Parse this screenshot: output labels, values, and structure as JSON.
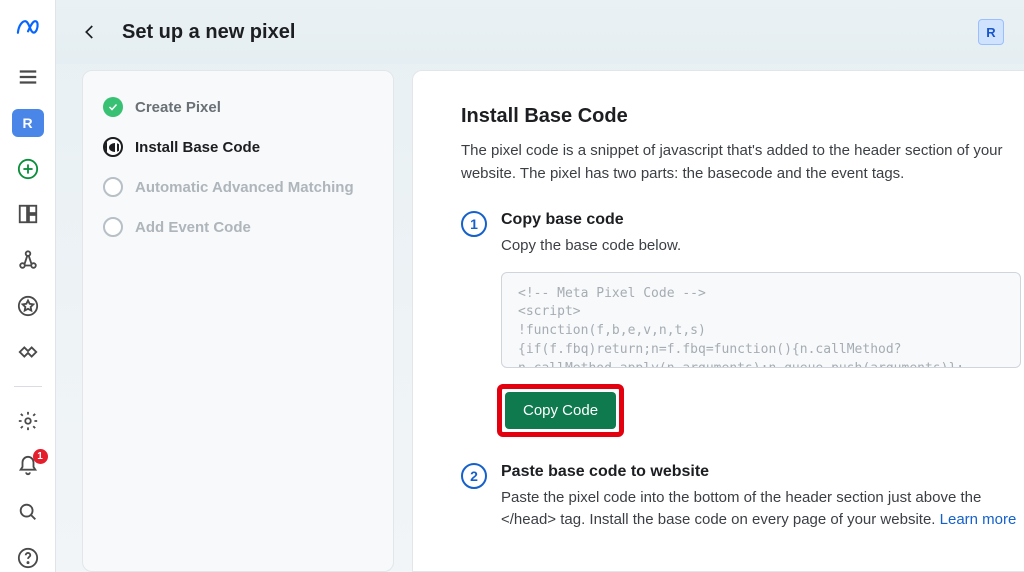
{
  "header": {
    "title": "Set up a new pixel",
    "account_badge": "R"
  },
  "sidebar": {
    "active_badge": "R",
    "notification_count": "1"
  },
  "stepper": {
    "steps": [
      {
        "label": "Create Pixel",
        "state": "done"
      },
      {
        "label": "Install Base Code",
        "state": "current"
      },
      {
        "label": "Automatic Advanced Matching",
        "state": "todo"
      },
      {
        "label": "Add Event Code",
        "state": "todo"
      }
    ]
  },
  "detail": {
    "heading": "Install Base Code",
    "intro": "The pixel code is a snippet of javascript that's added to the header section of your website. The pixel has two parts: the basecode and the event tags.",
    "step1": {
      "num": "1",
      "title": "Copy base code",
      "desc": "Copy the base code below.",
      "code": "<!-- Meta Pixel Code -->\n<script>\n!function(f,b,e,v,n,t,s)\n{if(f.fbq)return;n=f.fbq=function(){n.callMethod?\nn.callMethod.apply(n,arguments):n.queue.push(arguments)};",
      "copy_button": "Copy Code"
    },
    "step2": {
      "num": "2",
      "title": "Paste base code to website",
      "desc_a": "Paste the pixel code into the bottom of the header section just above the </head> tag. Install the base code on every page of your website. ",
      "learn_more": "Learn more"
    }
  }
}
